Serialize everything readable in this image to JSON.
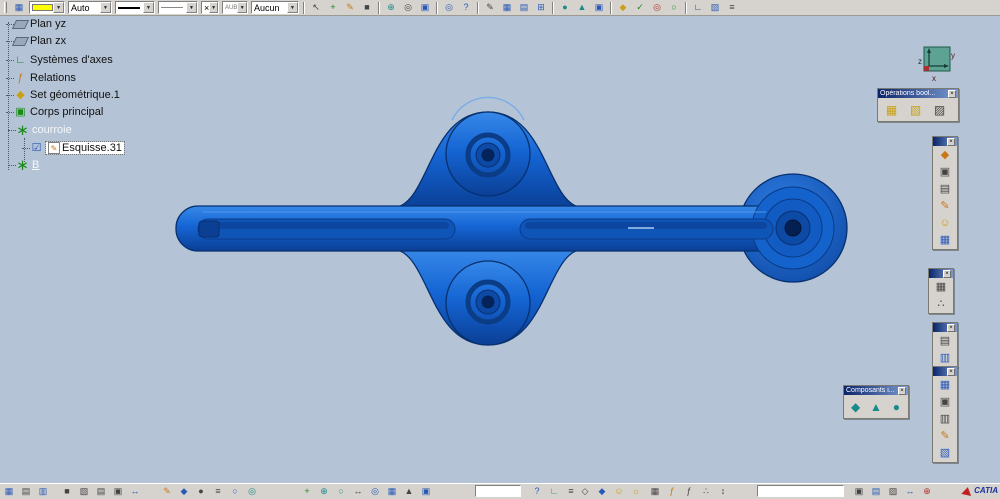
{
  "top_toolbar": {
    "opacity_value": "Auto",
    "point_value": "×",
    "layer_value": "AUB",
    "render_value": "Aucun"
  },
  "tree": {
    "items": [
      {
        "label": "Plan yz"
      },
      {
        "label": "Plan zx"
      },
      {
        "label": "Systèmes d'axes"
      },
      {
        "label": "Relations"
      },
      {
        "label": "Set géométrique.1"
      },
      {
        "label": "Corps principal"
      },
      {
        "label": "courroie"
      },
      {
        "label": "Esquisse.31"
      },
      {
        "label": "B"
      }
    ]
  },
  "compass": {
    "x": "x",
    "y": "y",
    "z": "z"
  },
  "palettes": {
    "operations_title": "Opérations bool...",
    "composants_title": "Composants i...",
    "close": "×"
  },
  "status_bar": {
    "field_value": "",
    "command_value": ""
  },
  "brand": "CATIA",
  "colors": {
    "part_blue": "#1464c8",
    "viewport_bg": "#b4c4d6",
    "chrome": "#d6d3ce",
    "fill_swatch": "#ffff00",
    "titlebar": "#0a246a"
  },
  "icons": {
    "down_arrow": "▼",
    "close": "×",
    "grid": "▦",
    "grid_h": "▤",
    "grid_v": "▥",
    "cube": "▣",
    "diamond": "◆",
    "diamond_open": "◇",
    "dot": "●",
    "ring": "◎",
    "circle": "○",
    "square": "■",
    "hatch": "▧",
    "hatch2": "▨",
    "check": "✓",
    "checkbox": "☑",
    "plus_box": "⊞",
    "plus_circle": "⊕",
    "plus": "+",
    "help": "?",
    "bars": "≡",
    "arrows_h": "↔",
    "arrows_v": "↕",
    "pointer": "↖",
    "pencil": "✎",
    "fx": "ƒ",
    "angle": "∟",
    "star": "∗",
    "face": "☺",
    "sun": "☼",
    "triangle": "▲",
    "dots": "∴"
  }
}
